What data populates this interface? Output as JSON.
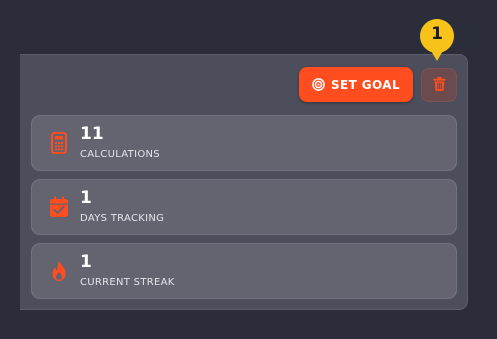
{
  "toolbar": {
    "set_goal_label": "SET GOAL",
    "set_goal_icon": "target-icon",
    "delete_icon": "trash-icon"
  },
  "badge": {
    "count": "1"
  },
  "stats": [
    {
      "value": "11",
      "label": "CALCULATIONS",
      "icon": "calculator-icon"
    },
    {
      "value": "1",
      "label": "DAYS TRACKING",
      "icon": "calendar-check-icon"
    },
    {
      "value": "1",
      "label": "CURRENT STREAK",
      "icon": "fire-icon"
    }
  ],
  "colors": {
    "accent": "#ff4d1f",
    "badge": "#f7c21a",
    "background": "#2b2d3b",
    "panel": "#4d4e5c",
    "card": "#63646f"
  }
}
